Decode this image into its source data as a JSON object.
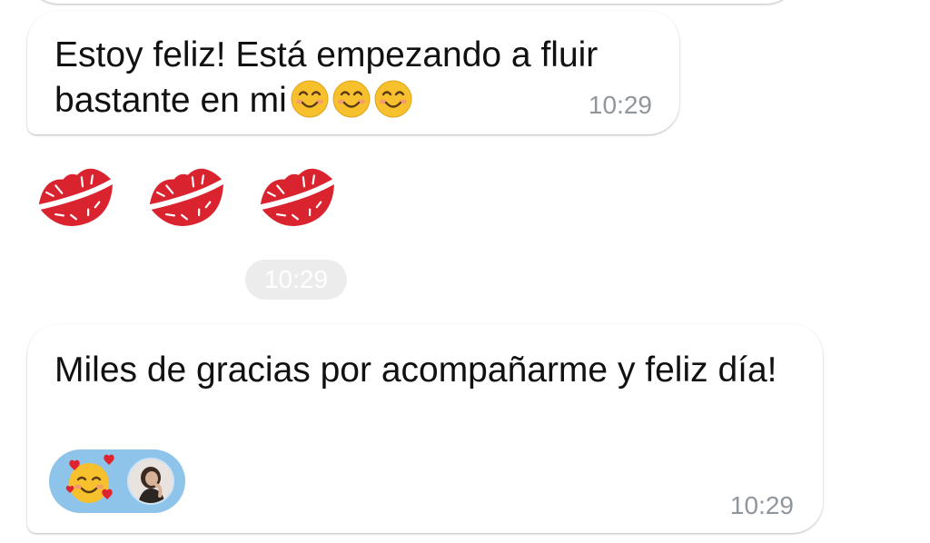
{
  "messages": [
    {
      "text": "Estoy feliz! Está empezando a fluir bastante en mi",
      "emoji": [
        "smiling-face-icon",
        "smiling-face-icon",
        "smiling-face-icon"
      ],
      "time": "10:29"
    },
    {
      "emoji": [
        "kiss-mark-icon",
        "kiss-mark-icon",
        "kiss-mark-icon"
      ],
      "time": "10:29"
    },
    {
      "text": "Miles de gracias por acompañarme  y feliz día!",
      "reaction": {
        "emoji": "smiling-face-with-hearts-icon",
        "avatar": "user-avatar"
      },
      "time": "10:29"
    }
  ],
  "colors": {
    "bubble": "#ffffff",
    "time_text": "#8f969c",
    "time_pill": "#ececec",
    "reaction_pill": "#8ec4ea",
    "kiss_red": "#d9232e"
  }
}
